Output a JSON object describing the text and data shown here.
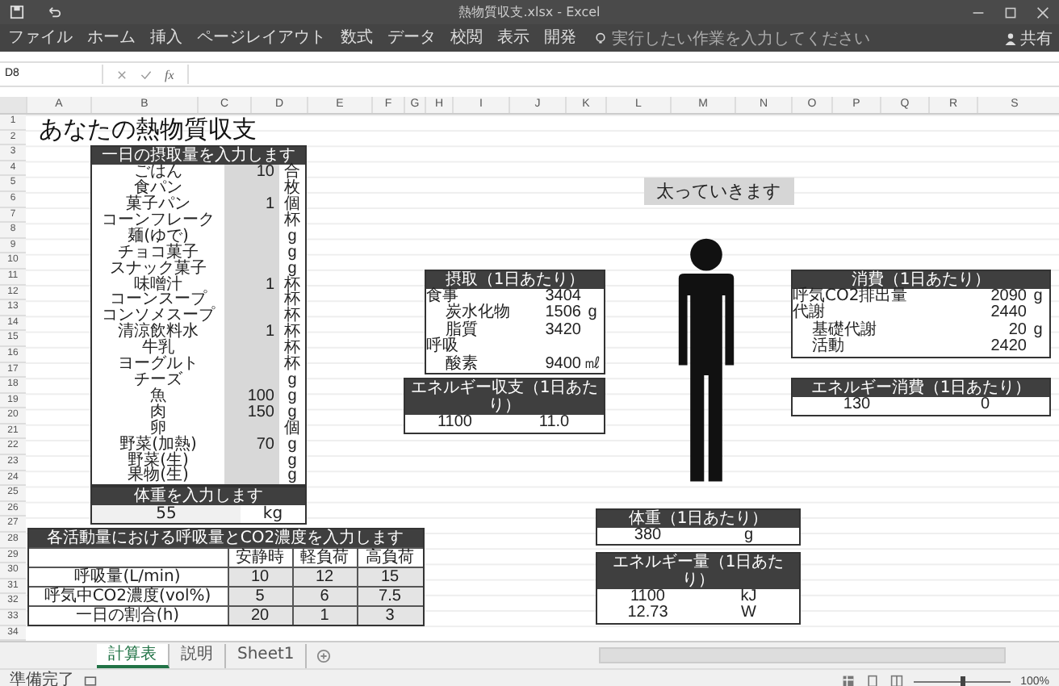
{
  "window": {
    "title": "熱物質収支.xlsx - Excel",
    "share": "共有"
  },
  "ribbon_tabs": [
    {
      "label": "ファイル",
      "selected": false
    },
    {
      "label": "ホーム",
      "selected": false
    },
    {
      "label": "挿入",
      "selected": false
    },
    {
      "label": "ページレイアウト",
      "selected": false
    },
    {
      "label": "数式",
      "selected": false
    },
    {
      "label": "データ",
      "selected": false
    },
    {
      "label": "校閲",
      "selected": false
    },
    {
      "label": "表示",
      "selected": false
    },
    {
      "label": "開発",
      "selected": false
    }
  ],
  "tell_me": {
    "placeholder": "実行したい作業を入力してください"
  },
  "formula_bar": {
    "name_box": "D8",
    "fx": "fx"
  },
  "columns": [
    "A",
    "B",
    "C",
    "D",
    "E",
    "F",
    "G",
    "H",
    "I",
    "J",
    "K",
    "L",
    "M",
    "N",
    "O",
    "P",
    "Q",
    "R",
    "S"
  ],
  "row_numbers": [
    "1",
    "2",
    "3",
    "4",
    "5",
    "6",
    "7",
    "8",
    "9",
    "10",
    "11",
    "12",
    "13",
    "14",
    "15",
    "16",
    "17",
    "18",
    "19",
    "20",
    "21",
    "22",
    "23",
    "24",
    "25",
    "26",
    "27",
    "28",
    "29",
    "30",
    "31",
    "32",
    "33",
    "34"
  ],
  "sheet": {
    "title": "あなたの熱物質収支",
    "intake": {
      "header": "一日の摂取量を入力します",
      "items": [
        {
          "name": "ごはん",
          "value": "10",
          "unit": "合"
        },
        {
          "name": "食パン",
          "unit": "枚"
        },
        {
          "name": "菓子パン",
          "value": "1",
          "unit": "個"
        },
        {
          "name": "コーンフレーク",
          "unit": "杯"
        },
        {
          "name": "麺(ゆで)",
          "unit": "g"
        },
        {
          "name": "チョコ菓子",
          "unit": "g"
        },
        {
          "name": "スナック菓子",
          "unit": "g"
        },
        {
          "name": "味噌汁",
          "value": "1",
          "unit": "杯"
        },
        {
          "name": "コーンスープ",
          "unit": "杯"
        },
        {
          "name": "コンソメスープ",
          "unit": "杯"
        },
        {
          "name": "清涼飲料水",
          "value": "1",
          "unit": "杯"
        },
        {
          "name": "牛乳",
          "unit": "杯"
        },
        {
          "name": "ヨーグルト",
          "unit": "杯"
        },
        {
          "name": "チーズ",
          "unit": "g"
        },
        {
          "name": "魚",
          "value": "100",
          "unit": "g"
        },
        {
          "name": "肉",
          "value": "150",
          "unit": "g"
        },
        {
          "name": "卵",
          "unit": "個"
        },
        {
          "name": "野菜(加熱)",
          "value": "70",
          "unit": "g"
        },
        {
          "name": "野菜(生)",
          "unit": "g"
        },
        {
          "name": "果物(生)",
          "unit": "g"
        }
      ]
    },
    "weight": {
      "header": "体重を入力します",
      "value": "55",
      "unit": "kg"
    },
    "activity": {
      "header": "各活動量における呼吸量とCO2濃度を入力します",
      "columns": [
        "安静時",
        "軽負荷",
        "高負荷"
      ],
      "rows": [
        {
          "label": "呼吸量(L/min)",
          "values": [
            "10",
            "12",
            "15"
          ]
        },
        {
          "label": "呼気中CO2濃度(vol%)",
          "values": [
            "5",
            "6",
            "7.5"
          ]
        },
        {
          "label": "一日の割合(h)",
          "values": [
            "20",
            "1",
            "3"
          ]
        }
      ]
    },
    "verdict": "太っていきます",
    "panels": [
      {
        "header": "摂取（1日あたり）",
        "rows": [
          {
            "label": "食事",
            "value": "3404",
            "children": [
              {
                "label": "炭水化物",
                "value": "1506",
                "unit": "g"
              },
              {
                "label": "脂質",
                "value": "3420"
              }
            ]
          },
          {
            "label": "呼吸",
            "children": [
              {
                "label": "酸素",
                "value": "9400",
                "unit": "㎖"
              }
            ]
          }
        ]
      },
      {
        "header": "エネルギー収支（1日あたり）",
        "rows": [
          {
            "value": "1100",
            "unit": "11.0"
          }
        ]
      },
      {
        "header": "消費（1日あたり）",
        "rows": [
          {
            "label": "呼気CO2排出量",
            "value": "2090",
            "unit": "g"
          },
          {
            "label": "代謝",
            "value": "2440",
            "children": [
              {
                "label": "基礎代謝",
                "value": "20",
                "unit": "g"
              },
              {
                "label": "活動",
                "value": "2420"
              }
            ]
          }
        ]
      },
      {
        "header": "エネルギー消費（1日あたり）",
        "rows": [
          {
            "value": "130",
            "unit": "0"
          }
        ]
      },
      {
        "header": "体重（1日あたり）",
        "rows": [
          {
            "value": "380",
            "unit": "g"
          }
        ]
      },
      {
        "header": "エネルギー量（1日あたり）",
        "rows": [
          {
            "value": "1100",
            "unit": "kJ"
          },
          {
            "value": "12.73",
            "unit": "W"
          }
        ]
      }
    ]
  },
  "sheet_tabs": [
    {
      "label": "計算表",
      "selected": true
    },
    {
      "label": "説明",
      "selected": false
    },
    {
      "label": "Sheet1",
      "selected": false
    }
  ],
  "status": {
    "text": "準備完了",
    "zoom": {
      "level": 0.5,
      "reading": "100%"
    }
  }
}
